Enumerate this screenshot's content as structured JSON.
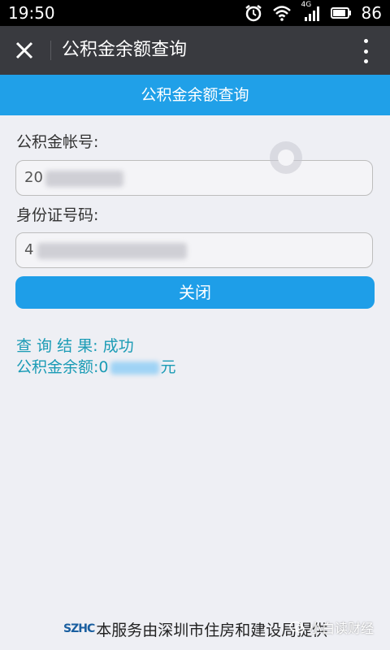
{
  "status_bar": {
    "time": "19:50",
    "battery": "86",
    "network": "4G"
  },
  "app_bar": {
    "title": "公积金余额查询",
    "close_icon": "close-icon",
    "menu_icon": "more-vert-icon"
  },
  "header": {
    "title": "公积金余额查询"
  },
  "form": {
    "account_label": "公积金帐号:",
    "account_value_visible": "20",
    "id_label": "身份证号码:",
    "id_value_visible": "4"
  },
  "close_button": {
    "label": "关闭"
  },
  "result": {
    "status_label": "查 询 结 果:",
    "status_value": "成功",
    "balance_label": "公积金余额:",
    "balance_prefix": "0",
    "balance_suffix": "元"
  },
  "footer": {
    "logo": "SZHC",
    "text": "本服务由深圳市住房和建设局提供"
  },
  "watermark": {
    "text": "小白读财经"
  },
  "colors": {
    "accent": "#20a0e8",
    "appbar": "#393a3f",
    "result_text": "#1a9bb5"
  }
}
